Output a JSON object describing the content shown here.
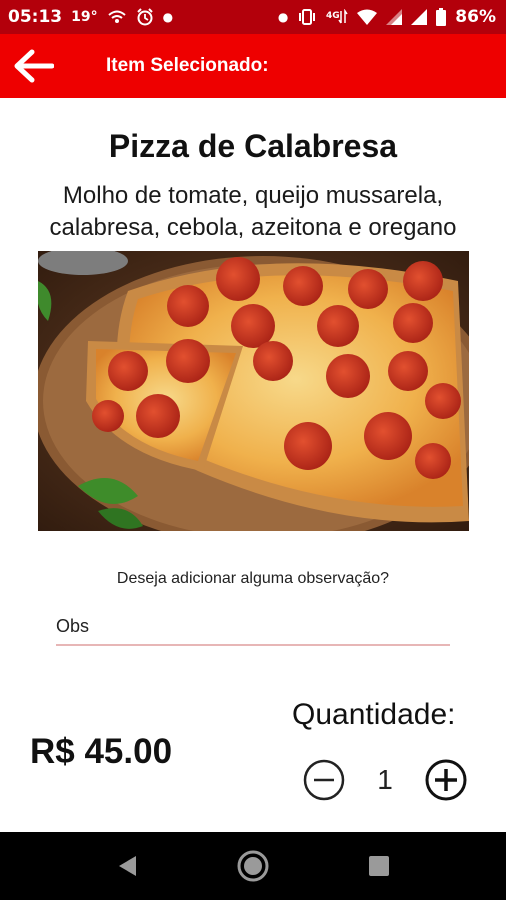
{
  "status_bar": {
    "time": "05:13",
    "temperature": "19°",
    "battery": "86%",
    "icons": [
      "wifi-calling-icon",
      "alarm-icon",
      "vibrate-icon",
      "4g-icon",
      "wifi-icon",
      "signal-icon",
      "battery-icon"
    ]
  },
  "app_bar": {
    "title": "Item Selecionado:",
    "back_icon": "arrow-left-icon",
    "color": "#ee0000"
  },
  "item": {
    "name": "Pizza de Calabresa",
    "description": "Molho de tomate, queijo mussarela, calabresa, cebola, azeitona e oregano",
    "image": "pizza-photo"
  },
  "observation": {
    "question": "Deseja adicionar alguma observação?",
    "placeholder": "Obs",
    "value": ""
  },
  "order": {
    "price": "R$ 45.00",
    "quantity_label": "Quantidade:",
    "quantity": "1",
    "decrement_icon": "minus-circle-icon",
    "increment_icon": "plus-circle-icon"
  },
  "nav_bar": {
    "buttons": [
      "back-triangle-icon",
      "home-circle-icon",
      "recents-square-icon"
    ]
  }
}
